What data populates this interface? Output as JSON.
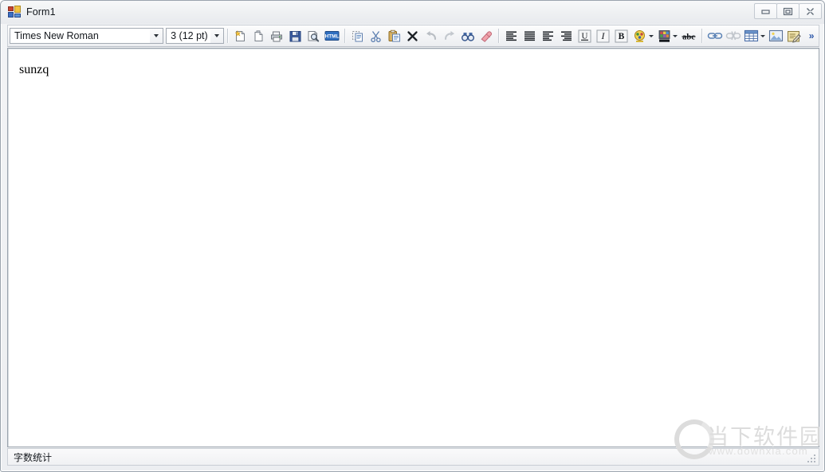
{
  "window": {
    "title": "Form1",
    "app_icon": "form-app-icon",
    "controls": [
      {
        "name": "minimize-button",
        "icon": "minimize-icon",
        "label": "Minimize"
      },
      {
        "name": "maximize-button",
        "icon": "maximize-icon",
        "label": "Maximize"
      },
      {
        "name": "close-button",
        "icon": "close-icon",
        "label": "Close"
      }
    ]
  },
  "toolbar": {
    "font_combo": {
      "value": "Times New Roman",
      "placeholder": "Font",
      "arrow_icon": "chevron-down-icon"
    },
    "size_combo": {
      "value": "3 (12 pt)",
      "placeholder": "Size",
      "arrow_icon": "chevron-down-icon"
    },
    "overflow_label": "»",
    "buttons": [
      {
        "name": "new-document-button",
        "icon": "new-document-icon",
        "label": "New"
      },
      {
        "name": "open-document-button",
        "icon": "open-document-icon",
        "label": "Open"
      },
      {
        "name": "print-button",
        "icon": "printer-icon",
        "label": "Print"
      },
      {
        "name": "save-button",
        "icon": "floppy-disk-icon",
        "label": "Save"
      },
      {
        "name": "print-preview-button",
        "icon": "print-preview-icon",
        "label": "Print Preview"
      },
      {
        "name": "html-source-button",
        "icon": "html-icon",
        "label": "HTML"
      },
      {
        "name": "copy-button",
        "icon": "copy-icon",
        "label": "Copy"
      },
      {
        "name": "cut-button",
        "icon": "scissors-icon",
        "label": "Cut"
      },
      {
        "name": "paste-button",
        "icon": "paste-icon",
        "label": "Paste"
      },
      {
        "name": "delete-button",
        "icon": "close-x-icon",
        "label": "Delete"
      },
      {
        "name": "undo-button",
        "icon": "undo-arrow-icon",
        "label": "Undo"
      },
      {
        "name": "redo-button",
        "icon": "redo-arrow-icon",
        "label": "Redo"
      },
      {
        "name": "find-button",
        "icon": "binoculars-icon",
        "label": "Find"
      },
      {
        "name": "clear-formatting-button",
        "icon": "eraser-icon",
        "label": "Clear Formatting"
      },
      {
        "name": "align-left-button",
        "icon": "align-left-icon",
        "label": "Align Left"
      },
      {
        "name": "align-justify-button",
        "icon": "align-justify-icon",
        "label": "Justify"
      },
      {
        "name": "align-center-button",
        "icon": "align-center-icon",
        "label": "Center"
      },
      {
        "name": "align-right-button",
        "icon": "align-right-icon",
        "label": "Align Right"
      },
      {
        "name": "underline-button",
        "icon": "underline-icon",
        "label": "U"
      },
      {
        "name": "italic-button",
        "icon": "italic-icon",
        "label": "I"
      },
      {
        "name": "bold-button",
        "icon": "bold-icon",
        "label": "B"
      },
      {
        "name": "font-color-button",
        "icon": "font-color-icon",
        "label": "Font Color"
      },
      {
        "name": "highlight-color-button",
        "icon": "highlight-color-icon",
        "label": "Highlight"
      },
      {
        "name": "strikethrough-button",
        "icon": "strikethrough-icon",
        "label": "abc"
      },
      {
        "name": "insert-link-button",
        "icon": "link-icon",
        "label": "Insert Link"
      },
      {
        "name": "remove-link-button",
        "icon": "unlink-icon",
        "label": "Remove Link"
      },
      {
        "name": "insert-table-button",
        "icon": "table-icon",
        "label": "Insert Table"
      },
      {
        "name": "insert-image-button",
        "icon": "image-icon",
        "label": "Insert Image"
      },
      {
        "name": "edit-signature-button",
        "icon": "pencil-note-icon",
        "label": "Edit"
      }
    ]
  },
  "editor": {
    "content": "sunzq",
    "font_family_display": "Times New Roman"
  },
  "statusbar": {
    "text": "字数统计",
    "grip_icon": "resize-grip-icon"
  },
  "watermark": {
    "site_name": "当下软件园",
    "url": "www.downxia.com",
    "logo_icon": "ring-logo-icon"
  },
  "colors": {
    "window_border": "#9aa3ad",
    "toolbar_bg": "#f4f5f7",
    "editor_bg": "#ffffff",
    "accent_blue": "#2a55a8",
    "watermark_gray": "#dcdcdc"
  }
}
